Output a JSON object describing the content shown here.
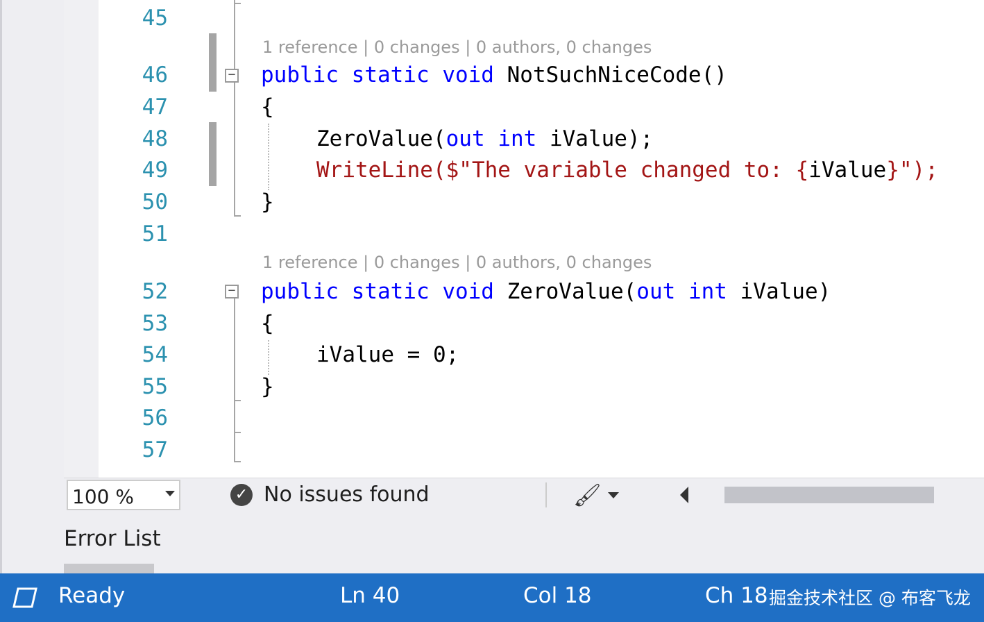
{
  "editor": {
    "line_numbers": [
      "45",
      "46",
      "47",
      "48",
      "49",
      "50",
      "51",
      "52",
      "53",
      "54",
      "55",
      "56",
      "57"
    ],
    "codelens": [
      "1 reference | 0 changes | 0 authors, 0 changes",
      "1 reference | 0 changes | 0 authors, 0 changes"
    ],
    "code": {
      "l46": {
        "kw1": "public",
        "kw2": "static",
        "kw3": "void",
        "rest": "NotSuchNiceCode()"
      },
      "l47": "{",
      "l48": {
        "a": "ZeroValue(",
        "kw1": "out",
        "kw2": "int",
        "b": "iValue);"
      },
      "l49": {
        "a": "WriteLine($\"The variable changed to: {",
        "b": "iValue",
        "c": "}\");"
      },
      "l50": "}",
      "l52": {
        "kw1": "public",
        "kw2": "static",
        "kw3": "void",
        "a": "ZeroValue(",
        "kw4": "out",
        "kw5": "int",
        "b": "iValue)"
      },
      "l53": "{",
      "l54": "iValue = 0;",
      "l55": "}"
    },
    "collapse_glyph": "−"
  },
  "editor_status": {
    "zoom": "100 %",
    "issues_icon": "check-circle-icon",
    "issues_text": "No issues found",
    "cleanup_icon": "brush-icon"
  },
  "error_list": {
    "title": "Error List"
  },
  "status_bar": {
    "icon": "output-window-icon",
    "ready": "Ready",
    "ln": "Ln 40",
    "col": "Col 18",
    "ch": "Ch 18",
    "watermark": "掘金技术社区 @ 布客飞龙",
    "color": "#1f6fc5"
  }
}
